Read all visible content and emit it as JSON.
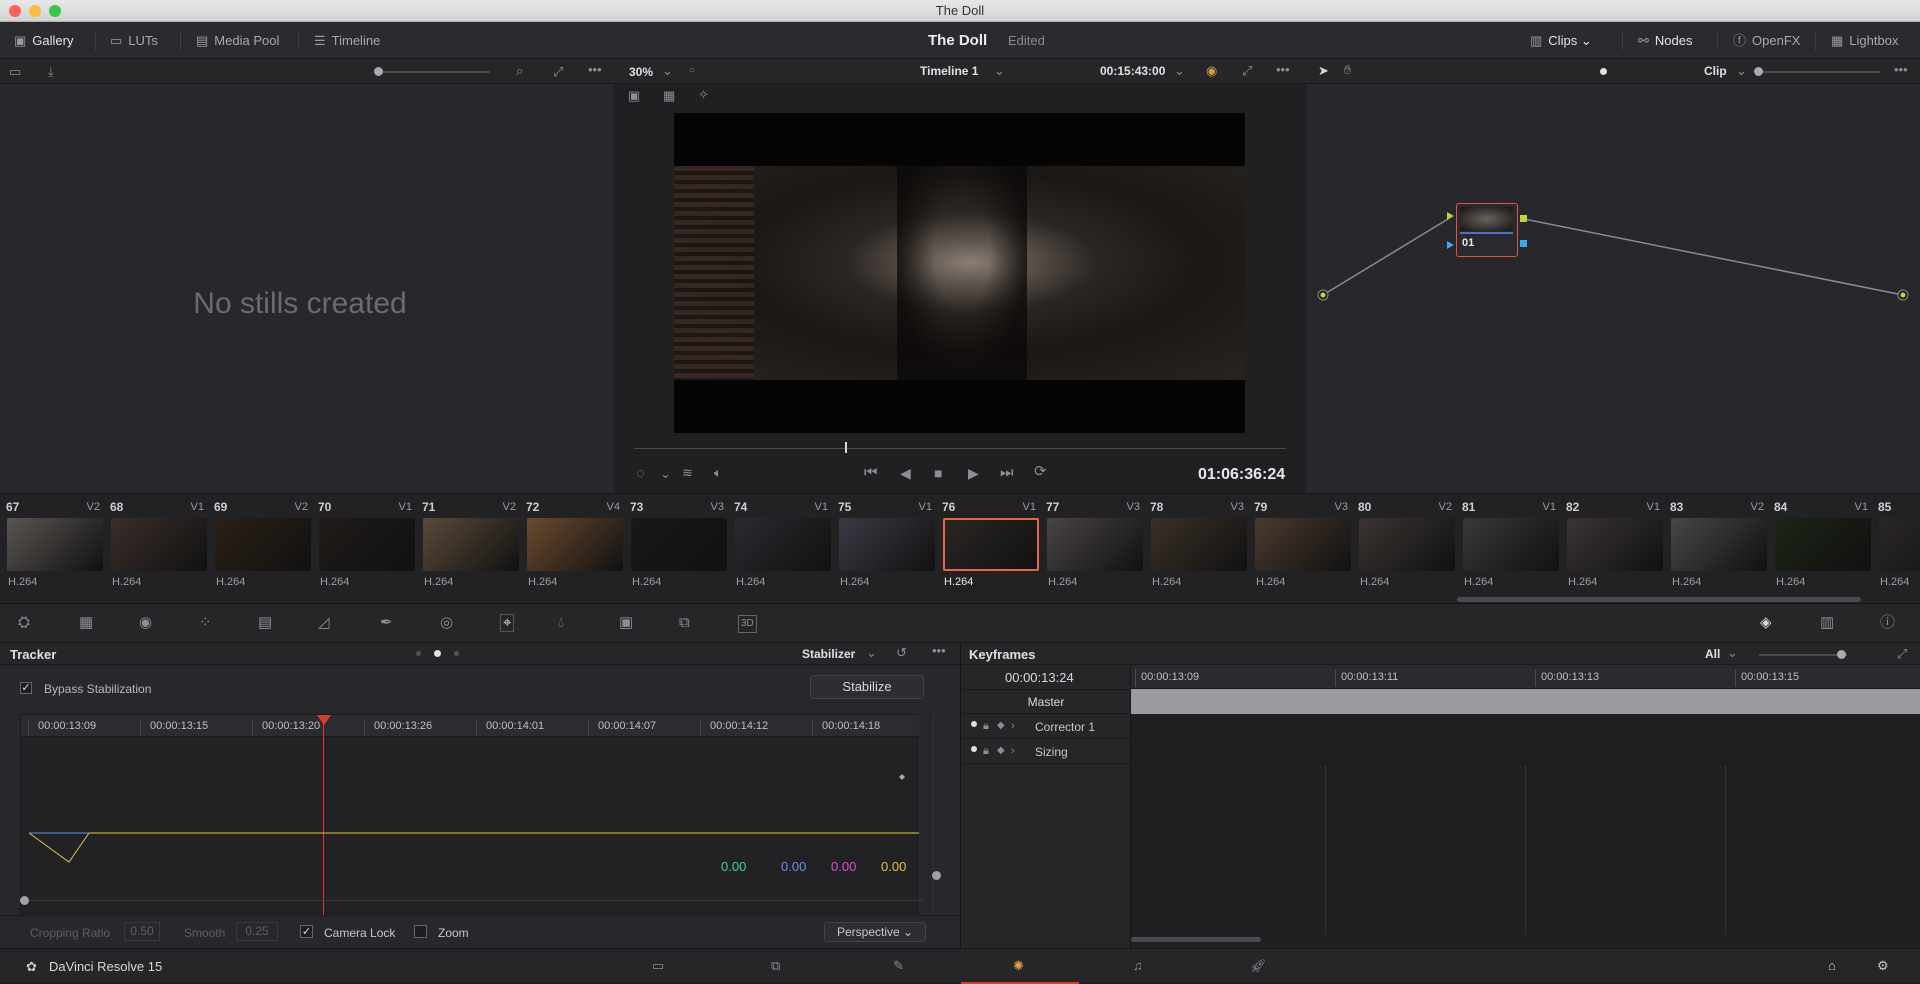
{
  "window": {
    "title": "The Doll"
  },
  "topbar": {
    "left": [
      {
        "label": "Gallery",
        "icon": "gallery-icon"
      },
      {
        "label": "LUTs",
        "icon": "luts-icon"
      },
      {
        "label": "Media Pool",
        "icon": "media-pool-icon"
      },
      {
        "label": "Timeline",
        "icon": "timeline-icon"
      }
    ],
    "project_name": "The Doll",
    "project_status": "Edited",
    "right": [
      {
        "label": "Clips",
        "icon": "clips-icon"
      },
      {
        "label": "Nodes",
        "icon": "nodes-icon"
      },
      {
        "label": "OpenFX",
        "icon": "openfx-icon"
      },
      {
        "label": "Lightbox",
        "icon": "lightbox-icon"
      }
    ]
  },
  "gallery": {
    "empty_text": "No stills created"
  },
  "viewer": {
    "zoom": "30%",
    "timeline_name": "Timeline 1",
    "duration": "00:15:43:00",
    "timecode": "01:06:36:24",
    "playhead_fraction": 0.33
  },
  "nodes": {
    "mode": "Clip",
    "node_label": "01"
  },
  "clips": [
    {
      "num": "67",
      "track": "V2",
      "codec": "H.264"
    },
    {
      "num": "68",
      "track": "V1",
      "codec": "H.264"
    },
    {
      "num": "69",
      "track": "V2",
      "codec": "H.264"
    },
    {
      "num": "70",
      "track": "V1",
      "codec": "H.264"
    },
    {
      "num": "71",
      "track": "V2",
      "codec": "H.264"
    },
    {
      "num": "72",
      "track": "V4",
      "codec": "H.264"
    },
    {
      "num": "73",
      "track": "V3",
      "codec": "H.264"
    },
    {
      "num": "74",
      "track": "V1",
      "codec": "H.264"
    },
    {
      "num": "75",
      "track": "V1",
      "codec": "H.264"
    },
    {
      "num": "76",
      "track": "V1",
      "codec": "H.264",
      "selected": true
    },
    {
      "num": "77",
      "track": "V3",
      "codec": "H.264"
    },
    {
      "num": "78",
      "track": "V3",
      "codec": "H.264"
    },
    {
      "num": "79",
      "track": "V3",
      "codec": "H.264"
    },
    {
      "num": "80",
      "track": "V2",
      "codec": "H.264"
    },
    {
      "num": "81",
      "track": "V1",
      "codec": "H.264"
    },
    {
      "num": "82",
      "track": "V1",
      "codec": "H.264"
    },
    {
      "num": "83",
      "track": "V2",
      "codec": "H.264"
    },
    {
      "num": "84",
      "track": "V1",
      "codec": "H.264"
    },
    {
      "num": "85",
      "track": "",
      "codec": "H.264"
    }
  ],
  "tracker": {
    "title": "Tracker",
    "mode": "Stabilizer",
    "bypass_label": "Bypass Stabilization",
    "stabilize_label": "Stabilize",
    "ruler": [
      "00:00:13:09",
      "00:00:13:15",
      "00:00:13:20",
      "00:00:13:26",
      "00:00:14:01",
      "00:00:14:07",
      "00:00:14:12",
      "00:00:14:18"
    ],
    "values": [
      {
        "value": "0.00",
        "color": "#3fd0a0"
      },
      {
        "value": "0.00",
        "color": "#6f8ff0"
      },
      {
        "value": "0.00",
        "color": "#e24ad8"
      },
      {
        "value": "0.00",
        "color": "#e8c43a"
      }
    ],
    "cropping_ratio_label": "Cropping Ratio",
    "cropping_ratio": "0.50",
    "smooth_label": "Smooth",
    "smooth": "0.25",
    "camera_lock_label": "Camera Lock",
    "zoom_label": "Zoom",
    "perspective_label": "Perspective"
  },
  "keyframes": {
    "title": "Keyframes",
    "filter": "All",
    "current": "00:00:13:24",
    "ruler": [
      "00:00:13:09",
      "00:00:13:11",
      "00:00:13:13",
      "00:00:13:15"
    ],
    "rows": [
      "Master",
      "Corrector 1",
      "Sizing"
    ]
  },
  "footer": {
    "app": "DaVinci Resolve 15"
  },
  "colors": {
    "accent": "#e8634a",
    "bg": "#1d1d20",
    "panel": "#28282c"
  }
}
